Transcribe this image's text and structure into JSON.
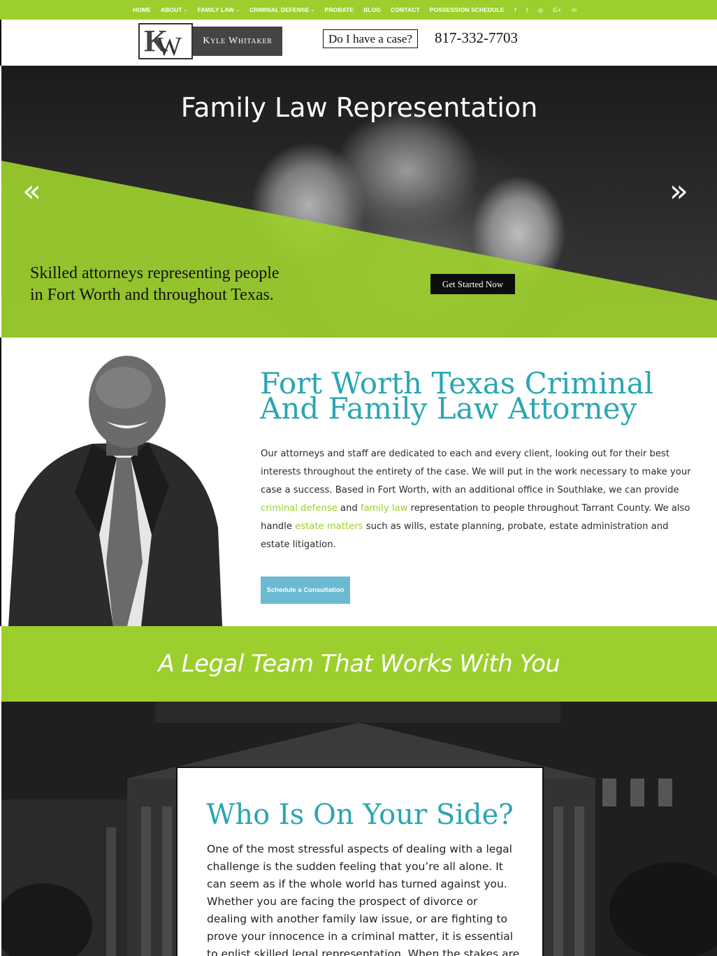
{
  "nav": {
    "items": [
      {
        "label": "HOME",
        "dropdown": false
      },
      {
        "label": "ABOUT",
        "dropdown": true
      },
      {
        "label": "FAMILY LAW",
        "dropdown": true
      },
      {
        "label": "CRIMINAL DEFENSE",
        "dropdown": true
      },
      {
        "label": "PROBATE",
        "dropdown": false
      },
      {
        "label": "BLOG",
        "dropdown": false
      },
      {
        "label": "CONTACT",
        "dropdown": false
      },
      {
        "label": "POSSESSION SCHEDULE",
        "dropdown": false
      }
    ],
    "social": [
      {
        "icon": "facebook-icon",
        "glyph": "f"
      },
      {
        "icon": "twitter-icon",
        "glyph": "t"
      },
      {
        "icon": "instagram-icon",
        "glyph": "◎"
      },
      {
        "icon": "google-plus-icon",
        "glyph": "G+"
      },
      {
        "icon": "linkedin-icon",
        "glyph": "in"
      }
    ]
  },
  "header": {
    "logo_mark": "KW",
    "logo_name": "Kyle Whitaker",
    "case_button": "Do I have a case?",
    "phone": "817-332-7703"
  },
  "hero": {
    "title": "Family Law Representation",
    "tagline_line1": "Skilled attorneys representing people",
    "tagline_line2": "in Fort Worth and throughout Texas.",
    "cta": "Get Started Now",
    "prev_arrow": "«",
    "next_arrow": "»"
  },
  "intro": {
    "title_line1": "Fort Worth Texas Criminal",
    "title_line2": "And Family Law Attorney",
    "text_part1": "Our attorneys and staff are dedicated to each and every client, looking out for their best interests throughout the entirety of the case. We will put in the work necessary to make your case a success. Based in Fort Worth, with an additional office in Southlake, we can provide ",
    "link_criminal": "criminal defense",
    "text_part2": " and ",
    "link_family": "family law",
    "text_part3": " representation to people throughout Tarrant County. We also handle ",
    "link_estate": "estate matters",
    "text_part4": " such as wills, estate planning, probate, estate administration and estate litigation.",
    "button": "Schedule a Consultation"
  },
  "band": {
    "heading": "A Legal Team That Works With You"
  },
  "side": {
    "heading": "Who Is On Your Side?",
    "text": "One of the most stressful aspects of dealing with a legal challenge is the sudden feeling that you’re all alone. It can seem as if the whole world has turned against you. Whether you are facing the prospect of divorce or dealing with another family law issue, or are fighting to prove your innocence in a criminal matter, it is essential to enlist skilled legal representation. When the stakes are high, you"
  },
  "colors": {
    "brand_green": "#9ccf2d",
    "heading_teal": "#2aa6b1",
    "button_blue": "#6cbad1"
  }
}
